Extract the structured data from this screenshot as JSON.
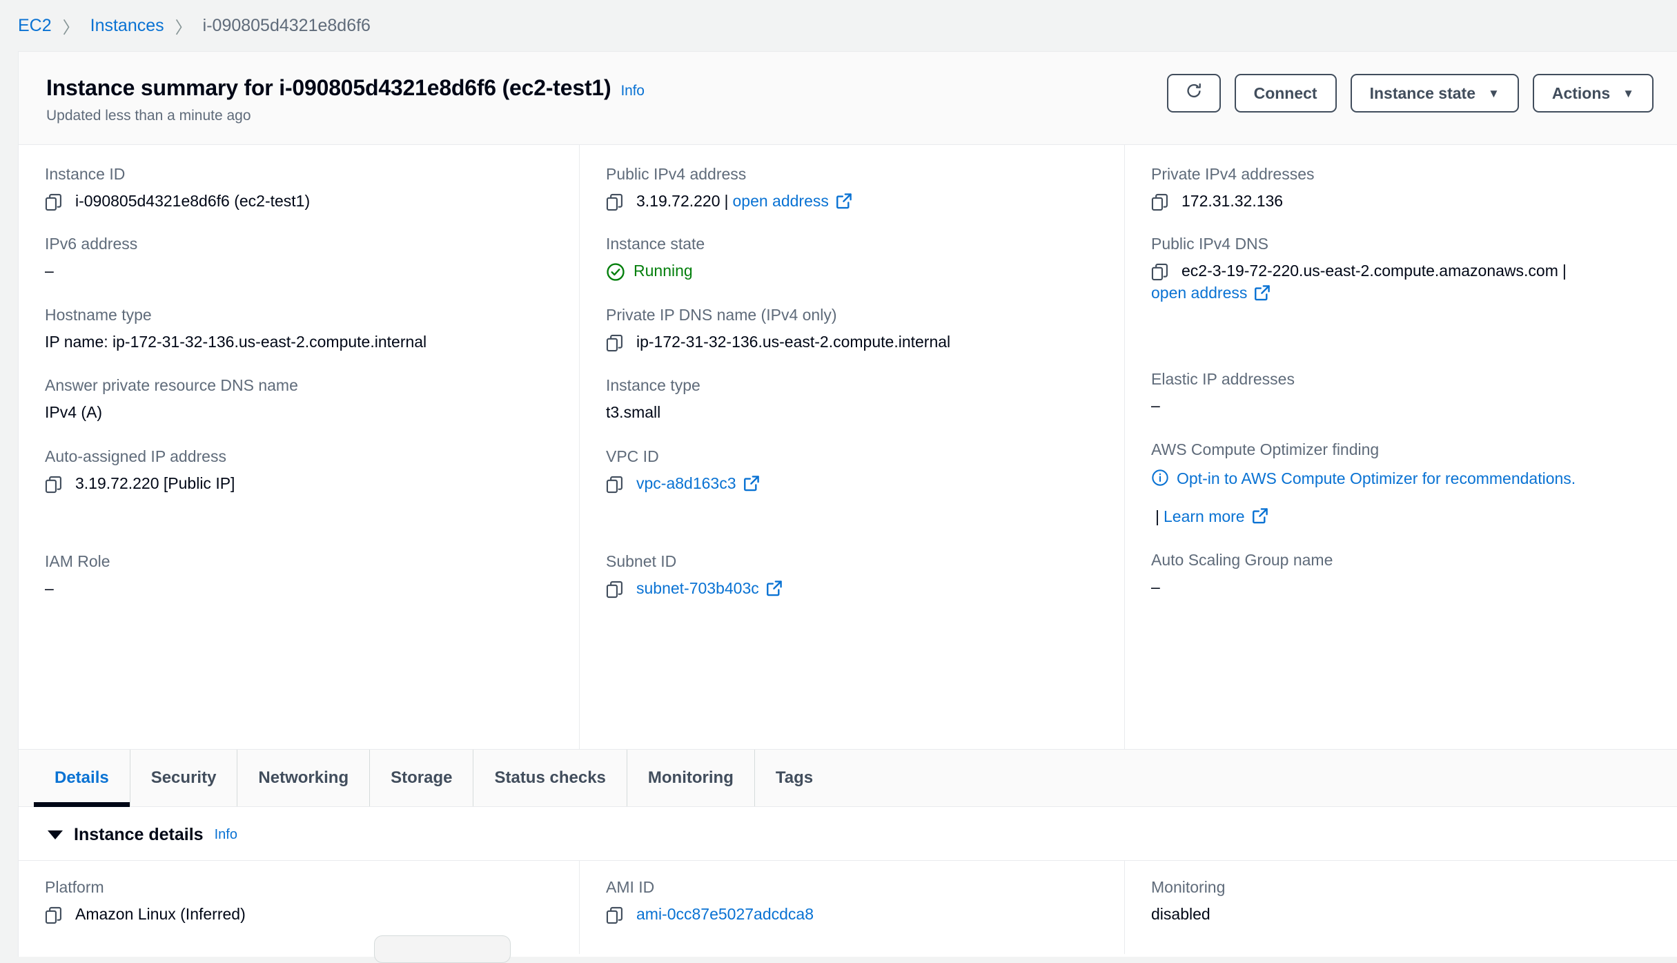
{
  "breadcrumb": {
    "items": [
      {
        "label": "EC2",
        "link": true
      },
      {
        "label": "Instances",
        "link": true
      },
      {
        "label": "i-090805d4321e8d6f6",
        "link": false
      }
    ],
    "separator": "〉"
  },
  "header": {
    "title": "Instance summary for i-090805d4321e8d6f6 (ec2-test1)",
    "info_label": "Info",
    "updated_text": "Updated less than a minute ago",
    "buttons": {
      "refresh_icon": "refresh-icon",
      "connect_label": "Connect",
      "instance_state_label": "Instance state",
      "actions_label": "Actions",
      "caret": "▼"
    }
  },
  "summary": {
    "col1": [
      {
        "label": "Instance ID",
        "value": "i-090805d4321e8d6f6 (ec2-test1)",
        "copy": true
      },
      {
        "label": "IPv6 address",
        "value": "–",
        "copy": false
      },
      {
        "label": "Hostname type",
        "value": "IP name: ip-172-31-32-136.us-east-2.compute.internal",
        "copy": false
      },
      {
        "label": "Answer private resource DNS name",
        "value": "IPv4 (A)",
        "copy": false
      },
      {
        "label": "Auto-assigned IP address",
        "value": "3.19.72.220 [Public IP]",
        "copy": true
      },
      {
        "label": "IAM Role",
        "value": "–",
        "copy": false
      }
    ],
    "col2": [
      {
        "label": "Public IPv4 address",
        "value": "3.19.72.220",
        "copy": true,
        "pipe": "|",
        "link_label": "open address",
        "external": true
      },
      {
        "label": "Instance state",
        "value": "Running",
        "status": "running"
      },
      {
        "label": "Private IP DNS name (IPv4 only)",
        "value": "ip-172-31-32-136.us-east-2.compute.internal",
        "copy": true
      },
      {
        "label": "Instance type",
        "value": "t3.small",
        "copy": false
      },
      {
        "label": "VPC ID",
        "value": "vpc-a8d163c3",
        "copy": true,
        "is_link": true,
        "external": true
      },
      {
        "label": "Subnet ID",
        "value": "subnet-703b403c",
        "copy": true,
        "is_link": true,
        "external": true
      }
    ],
    "col3": [
      {
        "label": "Private IPv4 addresses",
        "value": "172.31.32.136",
        "copy": true
      },
      {
        "label": "Public IPv4 DNS",
        "value": "ec2-3-19-72-220.us-east-2.compute.amazonaws.com",
        "copy": true,
        "pipe": "|",
        "link_label": "open address",
        "external": true
      },
      {
        "label": "Elastic IP addresses",
        "value": "–",
        "copy": false
      },
      {
        "label": "AWS Compute Optimizer finding",
        "value": "Opt-in to AWS Compute Optimizer for recommendations.",
        "info_icon": true,
        "is_link": true,
        "pipe": "|",
        "link_label": "Learn more",
        "external": true
      },
      {
        "label": "Auto Scaling Group name",
        "value": "–",
        "copy": false
      }
    ]
  },
  "tabs": [
    {
      "label": "Details",
      "active": true
    },
    {
      "label": "Security",
      "active": false
    },
    {
      "label": "Networking",
      "active": false
    },
    {
      "label": "Storage",
      "active": false
    },
    {
      "label": "Status checks",
      "active": false
    },
    {
      "label": "Monitoring",
      "active": false
    },
    {
      "label": "Tags",
      "active": false
    }
  ],
  "instance_details": {
    "section_title": "Instance details",
    "section_info": "Info",
    "fields": [
      {
        "label": "Platform",
        "value": "Amazon Linux (Inferred)",
        "copy": true,
        "is_link": false
      },
      {
        "label": "AMI ID",
        "value": "ami-0cc87e5027adcdca8",
        "copy": true,
        "is_link": true
      },
      {
        "label": "Monitoring",
        "value": "disabled",
        "copy": false,
        "is_link": false
      }
    ]
  },
  "colors": {
    "link": "#0972d3",
    "status_running": "#037f0c",
    "label": "#5f6b7a",
    "text": "#000716",
    "page_bg": "#f2f3f3",
    "header_bg": "#fafafa",
    "border": "#e9ebed"
  }
}
